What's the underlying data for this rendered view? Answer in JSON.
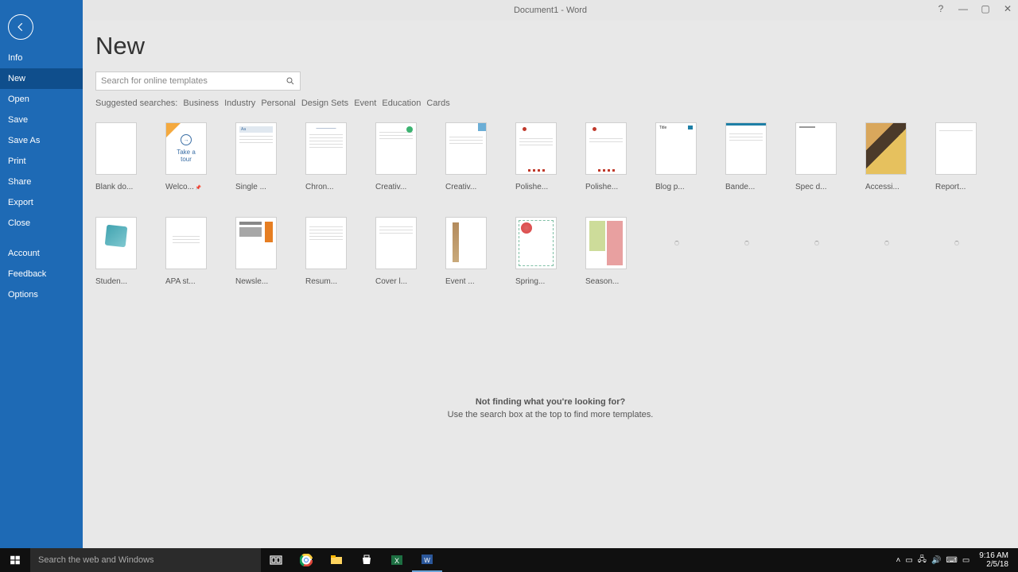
{
  "titlebar": {
    "text": "Document1  -  Word"
  },
  "nav": {
    "items": [
      {
        "label": "Info"
      },
      {
        "label": "New"
      },
      {
        "label": "Open"
      },
      {
        "label": "Save"
      },
      {
        "label": "Save As"
      },
      {
        "label": "Print"
      },
      {
        "label": "Share"
      },
      {
        "label": "Export"
      },
      {
        "label": "Close"
      }
    ],
    "items2": [
      {
        "label": "Account"
      },
      {
        "label": "Feedback"
      },
      {
        "label": "Options"
      }
    ],
    "selected": "New"
  },
  "page": {
    "title": "New"
  },
  "search": {
    "placeholder": "Search for online templates"
  },
  "suggested": {
    "label": "Suggested searches:",
    "links": [
      "Business",
      "Industry",
      "Personal",
      "Design Sets",
      "Event",
      "Education",
      "Cards"
    ]
  },
  "templates": [
    {
      "label": "Blank do..."
    },
    {
      "label": "Welco...",
      "pinned": true
    },
    {
      "label": "Single ..."
    },
    {
      "label": "Chron..."
    },
    {
      "label": "Creativ..."
    },
    {
      "label": "Creativ..."
    },
    {
      "label": "Polishe..."
    },
    {
      "label": "Polishe..."
    },
    {
      "label": "Blog p..."
    },
    {
      "label": "Bande..."
    },
    {
      "label": "Spec d..."
    },
    {
      "label": "Accessi..."
    },
    {
      "label": "Report..."
    },
    {
      "label": "Studen..."
    },
    {
      "label": "APA st..."
    },
    {
      "label": "Newsle..."
    },
    {
      "label": "Resum..."
    },
    {
      "label": "Cover l..."
    },
    {
      "label": "Event ..."
    },
    {
      "label": "Spring..."
    },
    {
      "label": "Season..."
    }
  ],
  "template_extra": {
    "tour_line1": "Take a",
    "tour_line2": "tour",
    "single_aa": "Aa",
    "blog_title": "Title"
  },
  "footer": {
    "heading": "Not finding what you're looking for?",
    "sub": "Use the search box at the top to find more templates."
  },
  "taskbar": {
    "search_placeholder": "Search the web and Windows",
    "time": "9:16 AM",
    "date": "2/5/18"
  }
}
